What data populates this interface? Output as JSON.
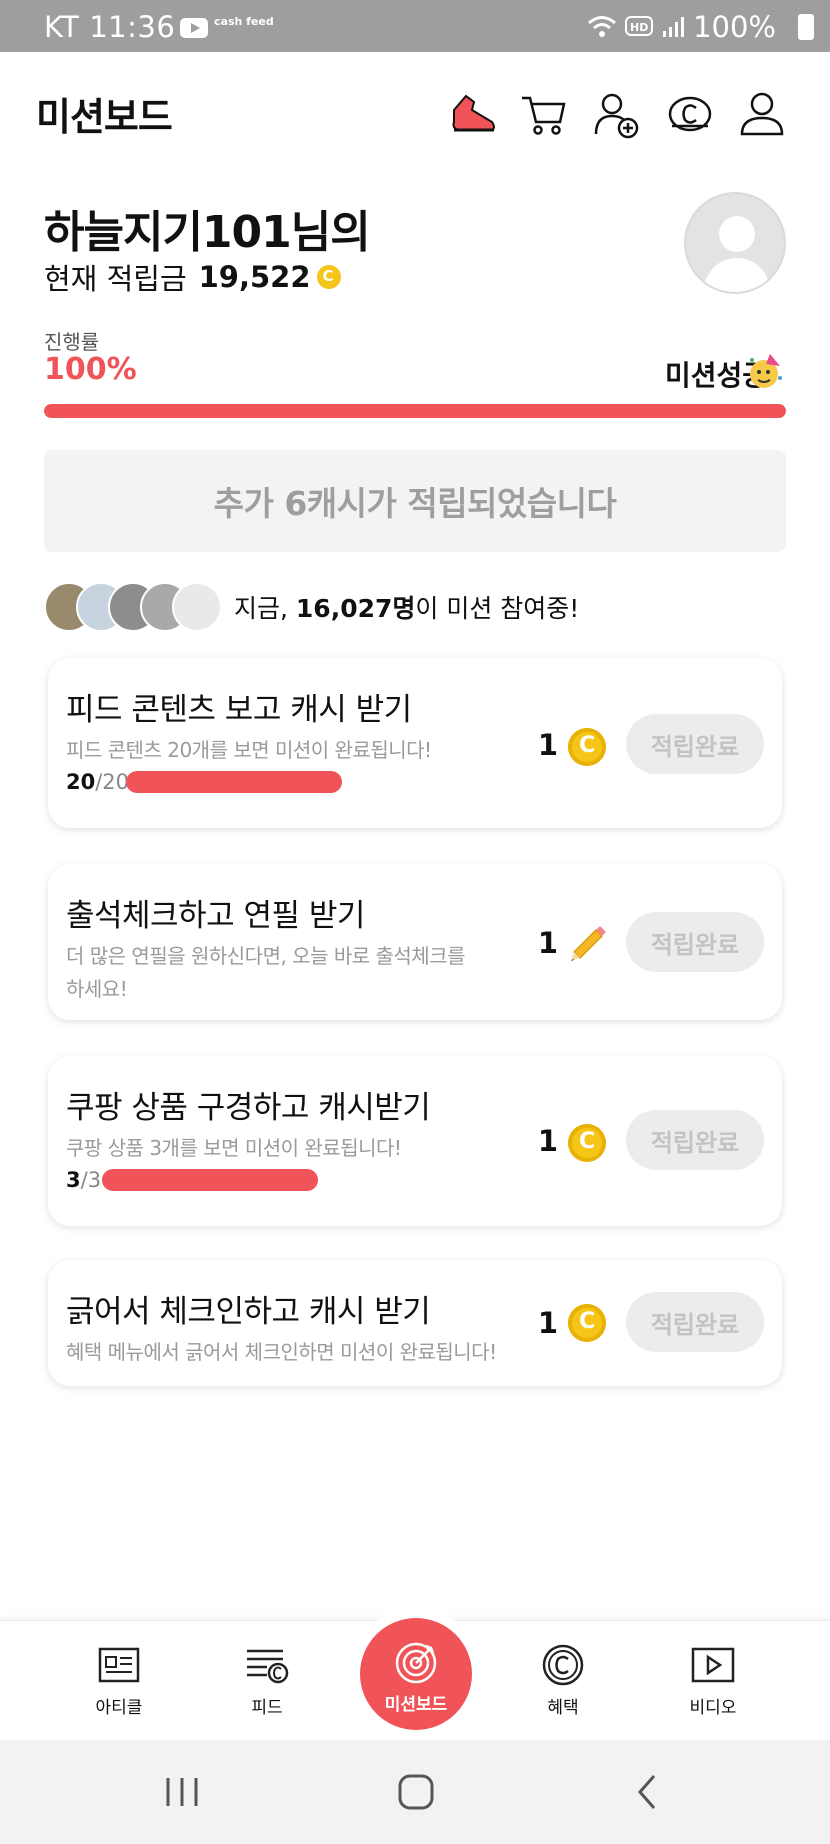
{
  "status_bar": {
    "carrier_time": "KT 11:36",
    "app_badge": "cash feed",
    "battery": "100%"
  },
  "header": {
    "title": "미션보드",
    "icons": [
      "sneaker-icon",
      "cart-icon",
      "add-friend-icon",
      "coin-icon",
      "profile-icon"
    ]
  },
  "profile": {
    "name": "하늘지기101님의",
    "balance_label": "현재 적립금",
    "balance_value": "19,522"
  },
  "progress": {
    "label": "진행률",
    "percent_text": "100%",
    "value": 1.0,
    "status": "미션성공"
  },
  "notice": "추가 6캐시가 적립되었습니다",
  "participants": {
    "prefix": "지금, ",
    "count": "16,027명",
    "suffix": "이 미션 참여중!"
  },
  "missions": [
    {
      "title": "피드 콘텐츠 보고 캐시 받기",
      "desc": "피드 콘텐츠 20개를 보면 미션이 완료됩니다!",
      "count_done": "20",
      "count_total": "/20",
      "progress": 1.0,
      "reward": "1",
      "reward_type": "coin",
      "button": "적립완료"
    },
    {
      "title": "출석체크하고 연필 받기",
      "desc": "더 많은 연필을 원하신다면, 오늘 바로 출석체크를 하세요!",
      "reward": "1",
      "reward_type": "pencil",
      "button": "적립완료"
    },
    {
      "title": "쿠팡 상품 구경하고 캐시받기",
      "desc": "쿠팡 상품 3개를 보면 미션이 완료됩니다!",
      "count_done": "3",
      "count_total": "/3",
      "progress": 1.0,
      "reward": "1",
      "reward_type": "coin",
      "button": "적립완료"
    },
    {
      "title": "긁어서 체크인하고 캐시 받기",
      "desc": "혜택 메뉴에서 긁어서 체크인하면 미션이 완료됩니다!",
      "reward": "1",
      "reward_type": "coin",
      "button": "적립완료"
    }
  ],
  "bottom_nav": {
    "items": [
      {
        "label": "아티클",
        "icon": "article-icon"
      },
      {
        "label": "피드",
        "icon": "feed-icon"
      },
      {
        "label": "미션보드",
        "icon": "target-icon",
        "active": true
      },
      {
        "label": "혜택",
        "icon": "benefit-coin-icon"
      },
      {
        "label": "비디오",
        "icon": "video-icon"
      }
    ]
  },
  "colors": {
    "accent": "#f05458",
    "coin": "#f5c518",
    "muted": "#9e9e9e"
  }
}
